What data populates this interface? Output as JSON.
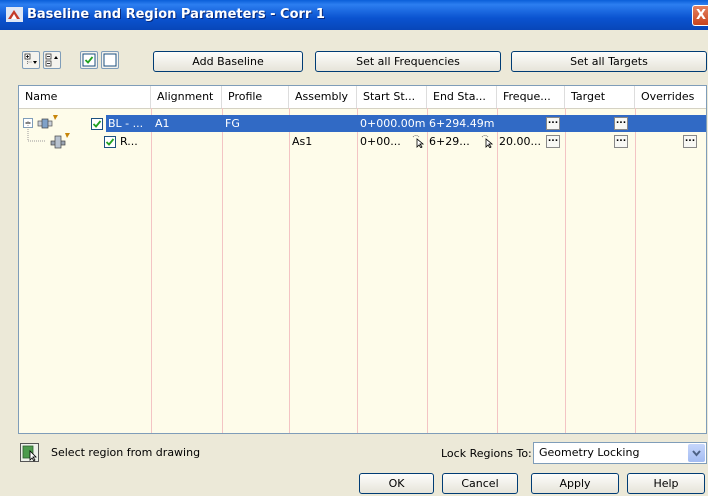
{
  "window": {
    "title": "Baseline and Region Parameters - Corr 1",
    "close_label": "X"
  },
  "toolbar": {
    "icons": [
      "expand-all-icon",
      "collapse-all-icon",
      "check-all-icon",
      "uncheck-all-icon"
    ],
    "add_baseline_label": "Add Baseline",
    "set_all_frequencies_label": "Set all Frequencies",
    "set_all_targets_label": "Set all Targets"
  },
  "grid": {
    "columns": [
      "Name",
      "Alignment",
      "Profile",
      "Assembly",
      "Start St...",
      "End Sta...",
      "Freque...",
      "Target",
      "Overrides"
    ],
    "rows": [
      {
        "name": "BL - ...",
        "alignment": "A1",
        "profile": "FG",
        "assembly": "",
        "start": "0+000.00m",
        "end": "6+294.49m",
        "frequency": "",
        "selected": true
      },
      {
        "name": "R...",
        "alignment": "",
        "profile": "",
        "assembly": "As1",
        "start": "0+00...",
        "end": "6+29...",
        "frequency": "20.00...",
        "selected": false
      }
    ],
    "ellipsis": "..."
  },
  "bottom": {
    "select_region_label": "Select region from drawing",
    "lock_regions_label": "Lock Regions To:",
    "lock_regions_value": "Geometry Locking"
  },
  "buttons": {
    "ok": "OK",
    "cancel": "Cancel",
    "apply": "Apply",
    "help": "Help"
  },
  "colors": {
    "title_bar": "#0a53d0",
    "selection": "#316ac5",
    "grid_background": "#fefcea",
    "dialog_background": "#ece9d8"
  }
}
